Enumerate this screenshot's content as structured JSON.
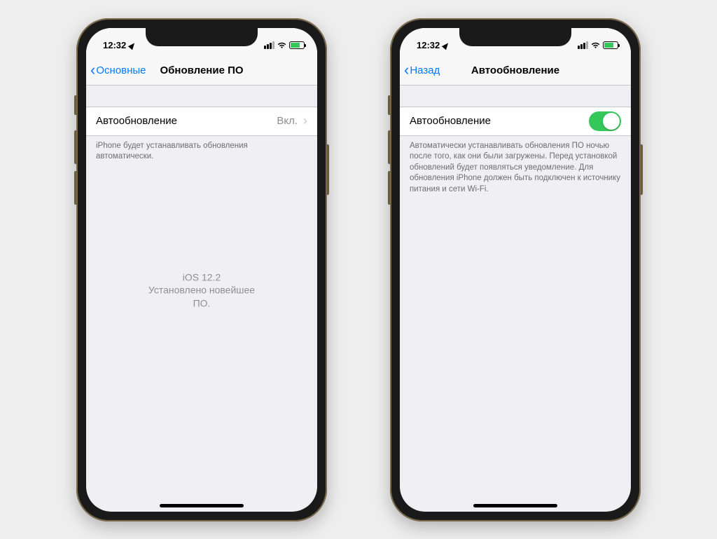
{
  "status": {
    "time": "12:32"
  },
  "phone1": {
    "nav": {
      "back": "Основные",
      "title": "Обновление ПО"
    },
    "cell": {
      "label": "Автообновление",
      "value": "Вкл."
    },
    "footer": "iPhone будет устанавливать обновления автоматически.",
    "center1": "iOS 12.2",
    "center2": "Установлено новейшее ПО."
  },
  "phone2": {
    "nav": {
      "back": "Назад",
      "title": "Автообновление"
    },
    "cell": {
      "label": "Автообновление"
    },
    "footer": "Автоматически устанавливать обновления ПО ночью после того, как они были загружены. Перед установкой обновлений будет появляться уведомление. Для обновления iPhone должен быть подключен к источнику питания и сети Wi-Fi."
  }
}
